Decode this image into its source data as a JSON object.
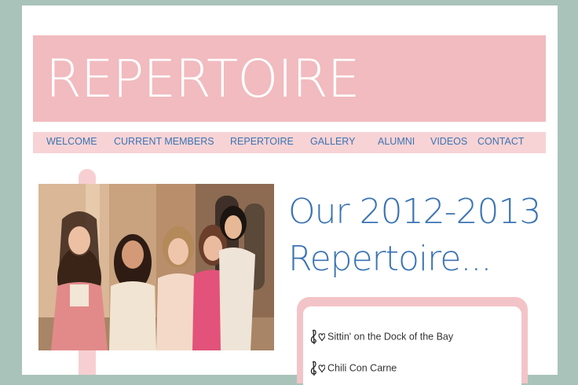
{
  "banner": {
    "title": "REPERTOIRE"
  },
  "nav": [
    {
      "label": "WELCOME"
    },
    {
      "label": "CURRENT MEMBERS"
    },
    {
      "label": "REPERTOIRE"
    },
    {
      "label": "GALLERY"
    },
    {
      "label": "ALUMNI"
    },
    {
      "label": "VIDEOS"
    },
    {
      "label": "CONTACT"
    }
  ],
  "main": {
    "heading_line1": "Our 2012-2013",
    "heading_line2": "Repertoire...",
    "songs": [
      {
        "title": "Sittin' on the Dock of the Bay",
        "icon": "treble-clef-heart-icon"
      },
      {
        "title": "Chili Con Carne",
        "icon": "treble-clef-heart-icon"
      }
    ]
  },
  "colors": {
    "background": "#a9c3bb",
    "banner": "#f1bbbf",
    "nav_bar": "#f8d3d5",
    "accent_text": "#3b74b3"
  }
}
